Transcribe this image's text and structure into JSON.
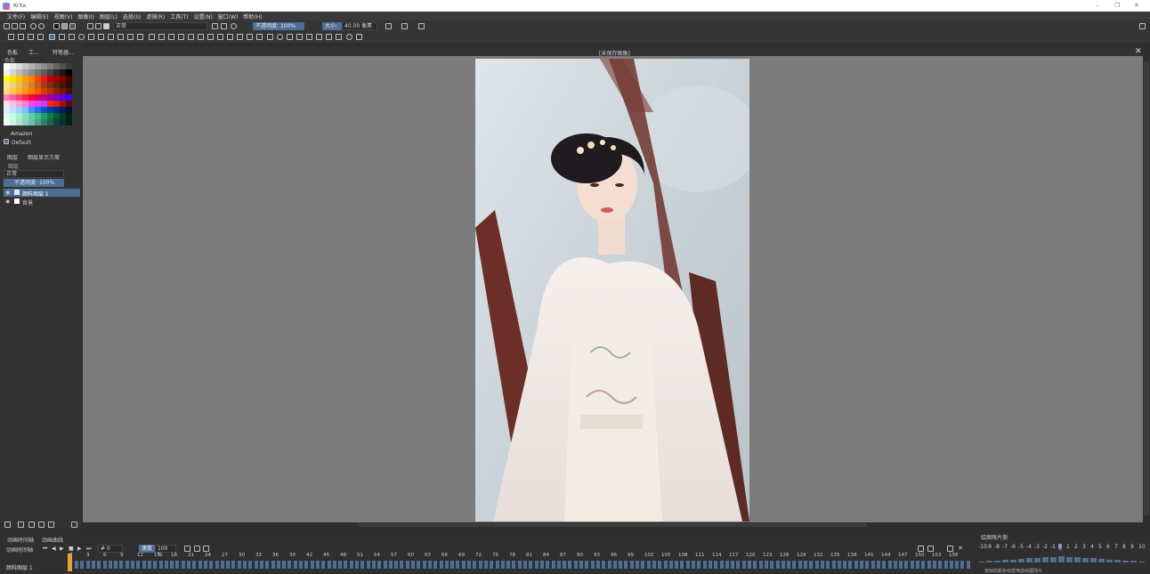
{
  "window": {
    "title": "Krita",
    "canvas_title": "[未保存图像]"
  },
  "menu": [
    "文件(F)",
    "编辑(E)",
    "视图(V)",
    "图像(I)",
    "图层(L)",
    "选择(S)",
    "滤镜(R)",
    "工具(T)",
    "设置(N)",
    "窗口(W)",
    "帮助(H)"
  ],
  "toolbar": {
    "blend_mode": "正常",
    "opacity_label": "不透明度:",
    "opacity_value": "100%",
    "size_label": "大小:",
    "size_value": "40.00 像素"
  },
  "left_dock": {
    "tabs": [
      "色板",
      "工...",
      "预设",
      "特笔器..."
    ],
    "palette_panel_title": "色板",
    "palette_name": "Amazon",
    "brush_preset": "Default",
    "sub_tabs": [
      "图层",
      "图层显示方案"
    ],
    "layers_title": "图层",
    "blend_mode": "正常",
    "opacity_label": "不透明度:",
    "opacity_value": "100%",
    "layers": [
      {
        "name": "颜料图层 1",
        "selected": true
      },
      {
        "name": "背景",
        "selected": false
      }
    ],
    "palette_colors": [
      [
        "#ffffff",
        "#ececec",
        "#dcdcdc",
        "#c8c8c8",
        "#b4b4b4",
        "#a0a0a0",
        "#8c8c8c",
        "#787878",
        "#646464",
        "#505050",
        "#3c3c3c"
      ],
      [
        "#f0f0f0",
        "#d4d4d4",
        "#bcbcbc",
        "#a4a4a4",
        "#8c8c8c",
        "#747474",
        "#5c5c5c",
        "#444444",
        "#2c2c2c",
        "#181818",
        "#000000"
      ],
      [
        "#ffff00",
        "#ffe000",
        "#ffc000",
        "#ffa000",
        "#ff8000",
        "#ff4000",
        "#e02020",
        "#c00000",
        "#a00000",
        "#800000",
        "#400000"
      ],
      [
        "#f4e4a0",
        "#f0d070",
        "#e8c050",
        "#e0a040",
        "#d08030",
        "#c06020",
        "#a04010",
        "#803010",
        "#602010",
        "#401808",
        "#201008"
      ],
      [
        "#ffe070",
        "#ffc850",
        "#ffb030",
        "#ff9800",
        "#ff7800",
        "#f05800",
        "#d04000",
        "#b03000",
        "#902000",
        "#701800",
        "#401000"
      ],
      [
        "#ff80c0",
        "#ff60a0",
        "#ff4080",
        "#ff2060",
        "#ff0040",
        "#e00060",
        "#c00080",
        "#a000a0",
        "#8000c0",
        "#6000e0",
        "#4000ff"
      ],
      [
        "#ffe0f0",
        "#ffc0e0",
        "#ffa0d0",
        "#ff80c0",
        "#ff40ff",
        "#e040ff",
        "#c040ff",
        "#ff2020",
        "#d02020",
        "#a01010",
        "#600808"
      ],
      [
        "#e0f0ff",
        "#c0e0ff",
        "#a0d0ff",
        "#80c0ff",
        "#4090ff",
        "#2070e0",
        "#1050c0",
        "#0040a0",
        "#003080",
        "#002060",
        "#001040"
      ],
      [
        "#e0fff0",
        "#c0ffe0",
        "#a0f0d0",
        "#80e0c0",
        "#60d0a0",
        "#40c080",
        "#20a060",
        "#108040",
        "#006030",
        "#004020",
        "#002010"
      ],
      [
        "#f0fff0",
        "#d0f0e0",
        "#b0e0d0",
        "#90d0c0",
        "#70c0b0",
        "#50a090",
        "#308070",
        "#206050",
        "#104040",
        "#083030",
        "#002020"
      ]
    ]
  },
  "timeline": {
    "tabs": [
      "动画时间轴",
      "动画曲线"
    ],
    "row_label": "动画时间轴",
    "layer_label": "颜料图层 1",
    "current_frame": "0",
    "speed_label": "速度",
    "zoom": "100 %",
    "frame_numbers": [
      "0",
      "3",
      "6",
      "9",
      "12",
      "15",
      "18",
      "21",
      "24",
      "27",
      "30",
      "33",
      "36",
      "39",
      "42",
      "45",
      "48",
      "51",
      "54",
      "57",
      "60",
      "63",
      "66",
      "69",
      "72",
      "75",
      "78",
      "81",
      "84",
      "87",
      "90",
      "93",
      "96",
      "99",
      "102",
      "105",
      "108",
      "111",
      "114",
      "117",
      "120",
      "123",
      "126",
      "129",
      "132",
      "135",
      "138",
      "141",
      "144",
      "147",
      "150",
      "153",
      "156"
    ]
  },
  "onion": {
    "title": "绘图残片渐",
    "numbers": [
      "-10",
      "-9",
      "-8",
      "-7",
      "-6",
      "-5",
      "-4",
      "-3",
      "-2",
      "-1",
      "0",
      "1",
      "2",
      "3",
      "4",
      "5",
      "6",
      "7",
      "8",
      "9",
      "10"
    ],
    "footer": "按帧的颜色标签筛选绘图残片"
  }
}
